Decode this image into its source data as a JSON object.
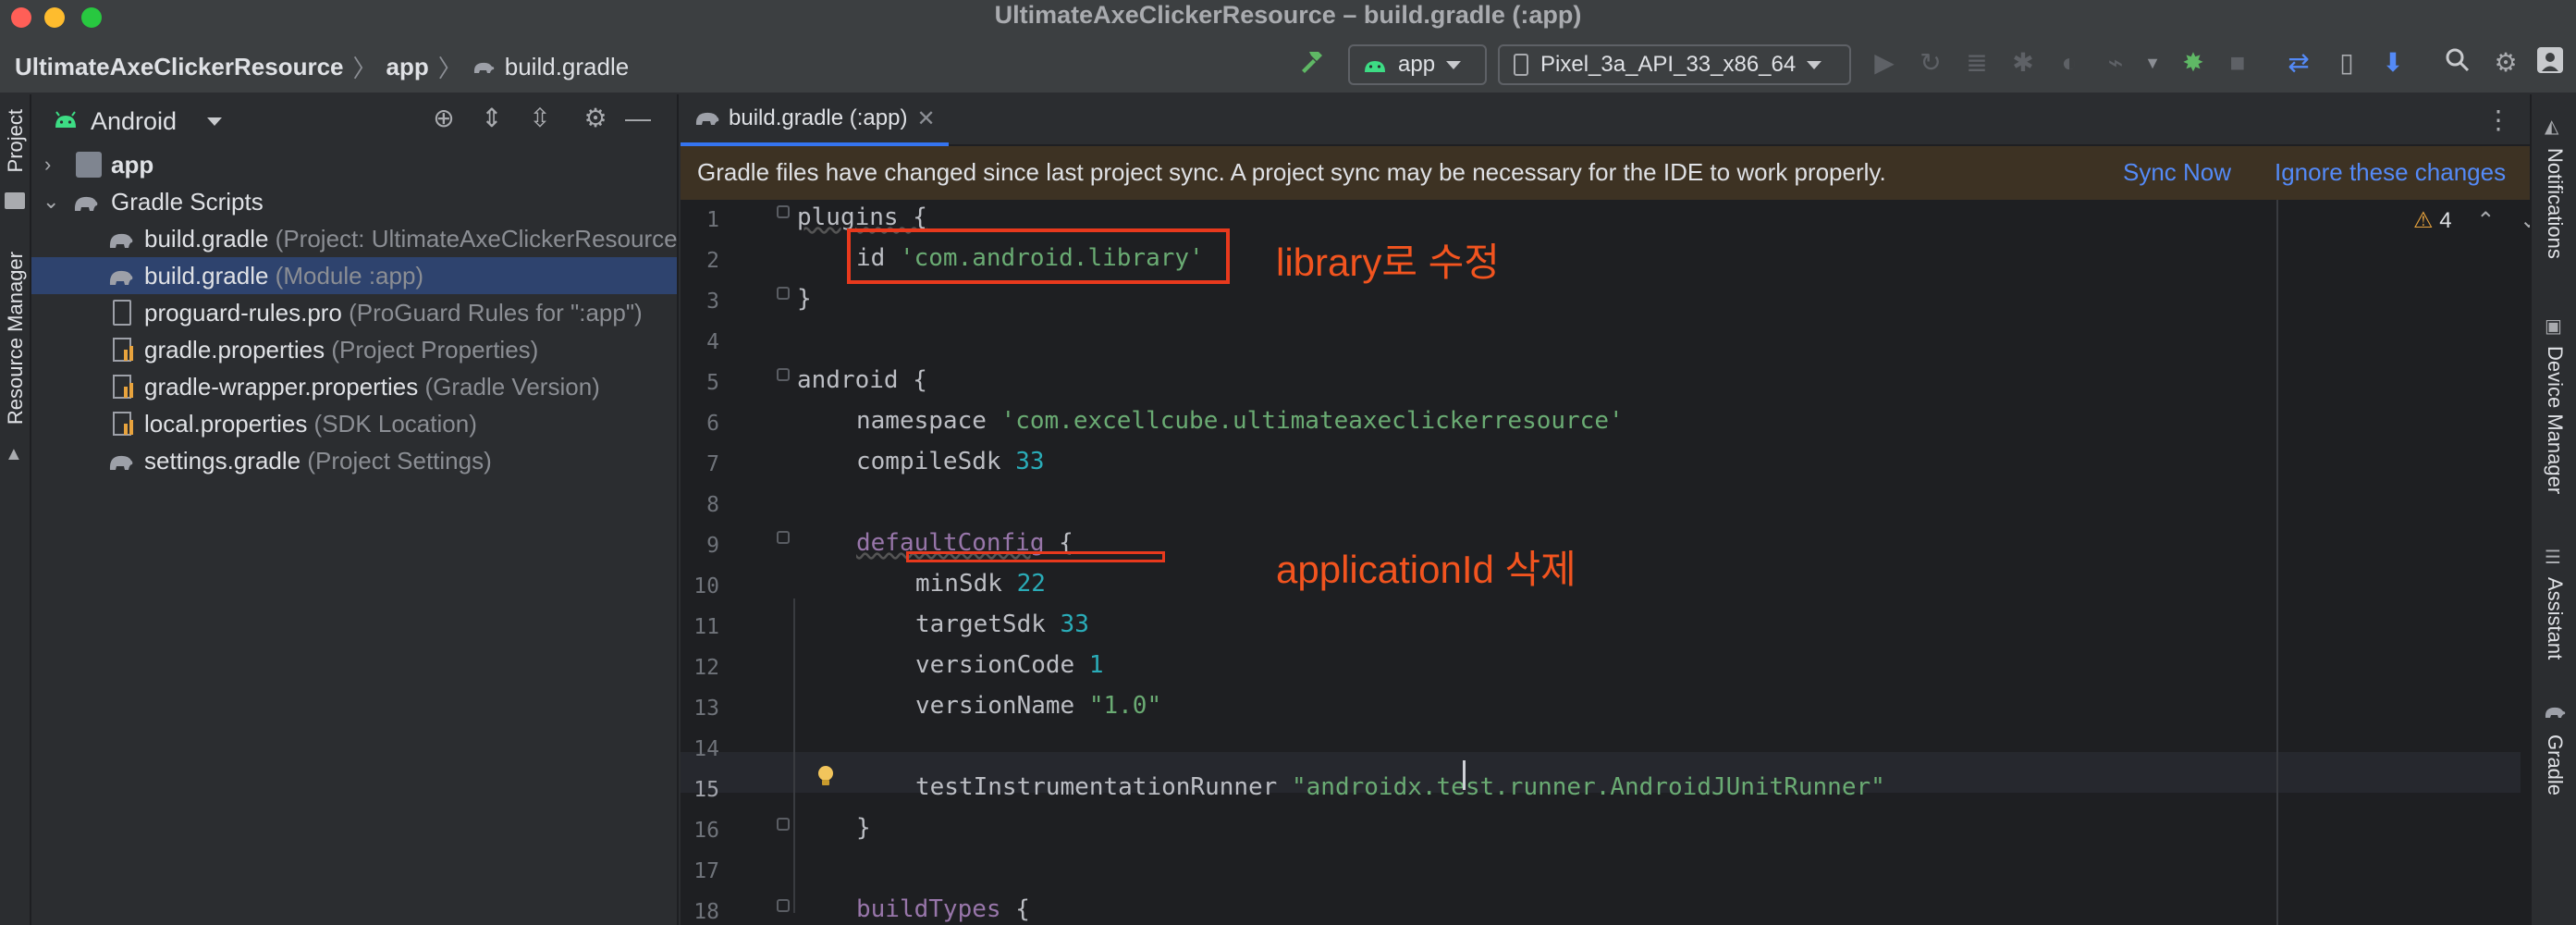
{
  "window": {
    "title": "UltimateAxeClickerResource – build.gradle (:app)"
  },
  "toolbar": {
    "breadcrumb": [
      "UltimateAxeClickerResource",
      "app",
      "build.gradle"
    ],
    "run_config": "app",
    "device": "Pixel_3a_API_33_x86_64"
  },
  "left_strip": {
    "project_label": "Project",
    "resource_manager_label": "Resource Manager"
  },
  "project_panel": {
    "view_selector": "Android",
    "items": [
      {
        "label": "app",
        "detail": ""
      },
      {
        "label": "Gradle Scripts",
        "detail": ""
      },
      {
        "label": "build.gradle",
        "detail": "(Project: UltimateAxeClickerResource)"
      },
      {
        "label": "build.gradle",
        "detail": "(Module :app)"
      },
      {
        "label": "proguard-rules.pro",
        "detail": "(ProGuard Rules for \":app\")"
      },
      {
        "label": "gradle.properties",
        "detail": "(Project Properties)"
      },
      {
        "label": "gradle-wrapper.properties",
        "detail": "(Gradle Version)"
      },
      {
        "label": "local.properties",
        "detail": "(SDK Location)"
      },
      {
        "label": "settings.gradle",
        "detail": "(Project Settings)"
      }
    ]
  },
  "editor": {
    "tab_label": "build.gradle (:app)",
    "notification": "Gradle files have changed since last project sync. A project sync may be necessary for the IDE to work properly.",
    "sync_now": "Sync Now",
    "ignore_changes": "Ignore these changes",
    "warning_count": "4",
    "line_numbers": [
      "1",
      "2",
      "3",
      "4",
      "5",
      "6",
      "7",
      "8",
      "9",
      "10",
      "11",
      "12",
      "13",
      "14",
      "15",
      "16",
      "17",
      "18"
    ],
    "current_line": "15",
    "code": {
      "l1": "plugins {",
      "l2_kw": "id ",
      "l2_str": "'com.android.library'",
      "l3": "}",
      "l5": "android {",
      "l6_kw": "namespace ",
      "l6_str": "'com.excellcube.ultimateaxeclickerresource'",
      "l7_kw": "compileSdk ",
      "l7_num": "33",
      "l9_meth": "defaultConfig",
      "l9_rest": " {",
      "l10_kw": "minSdk ",
      "l10_num": "22",
      "l11_kw": "targetSdk ",
      "l11_num": "33",
      "l12_kw": "versionCode ",
      "l12_num": "1",
      "l13_kw": "versionName ",
      "l13_str": "\"1.0\"",
      "l15_kw": "testInstrumentationRunner ",
      "l15_str": "\"androidx.test.runner.AndroidJUnitRunner\"",
      "l16": "}",
      "l18_meth": "buildTypes",
      "l18_rest": " {"
    }
  },
  "annotations": {
    "library_note": "library로 수정",
    "appid_note": "applicationId 삭제"
  },
  "right_strip": {
    "notifications": "Notifications",
    "device_manager": "Device Manager",
    "assistant": "Assistant",
    "gradle": "Gradle"
  },
  "colors": {
    "accent": "#3574f0",
    "annotation": "#e8391d",
    "string": "#6aab73",
    "number": "#2aacb8"
  }
}
